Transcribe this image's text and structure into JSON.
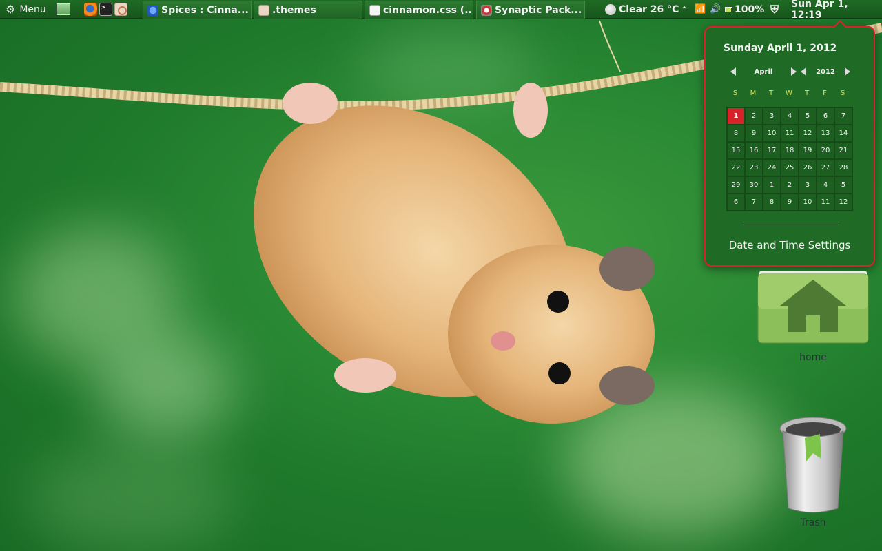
{
  "panel": {
    "menu_label": "Menu",
    "tasks": [
      {
        "label": "Spices : Cinna..."
      },
      {
        "label": ".themes"
      },
      {
        "label": "cinnamon.css (..."
      },
      {
        "label": "Synaptic Pack..."
      }
    ],
    "weather": "Clear 26 °C",
    "battery": "100%",
    "clock": "Sun Apr  1, 12:19"
  },
  "calendar": {
    "full_date": "Sunday April  1, 2012",
    "month": "April",
    "year": "2012",
    "weekdays": [
      "S",
      "M",
      "T",
      "W",
      "T",
      "F",
      "S"
    ],
    "days": [
      "1",
      "2",
      "3",
      "4",
      "5",
      "6",
      "7",
      "8",
      "9",
      "10",
      "11",
      "12",
      "13",
      "14",
      "15",
      "16",
      "17",
      "18",
      "19",
      "20",
      "21",
      "22",
      "23",
      "24",
      "25",
      "26",
      "27",
      "28",
      "29",
      "30",
      "1",
      "2",
      "3",
      "4",
      "5",
      "6",
      "7",
      "8",
      "9",
      "10",
      "11",
      "12"
    ],
    "today_index": 0,
    "settings_label": "Date and Time Settings"
  },
  "desktop": {
    "home_label": "home",
    "trash_label": "Trash"
  },
  "colors": {
    "panel": "#1f6b25",
    "accent": "#d8222a",
    "weekday_text": "#e8e24a"
  }
}
